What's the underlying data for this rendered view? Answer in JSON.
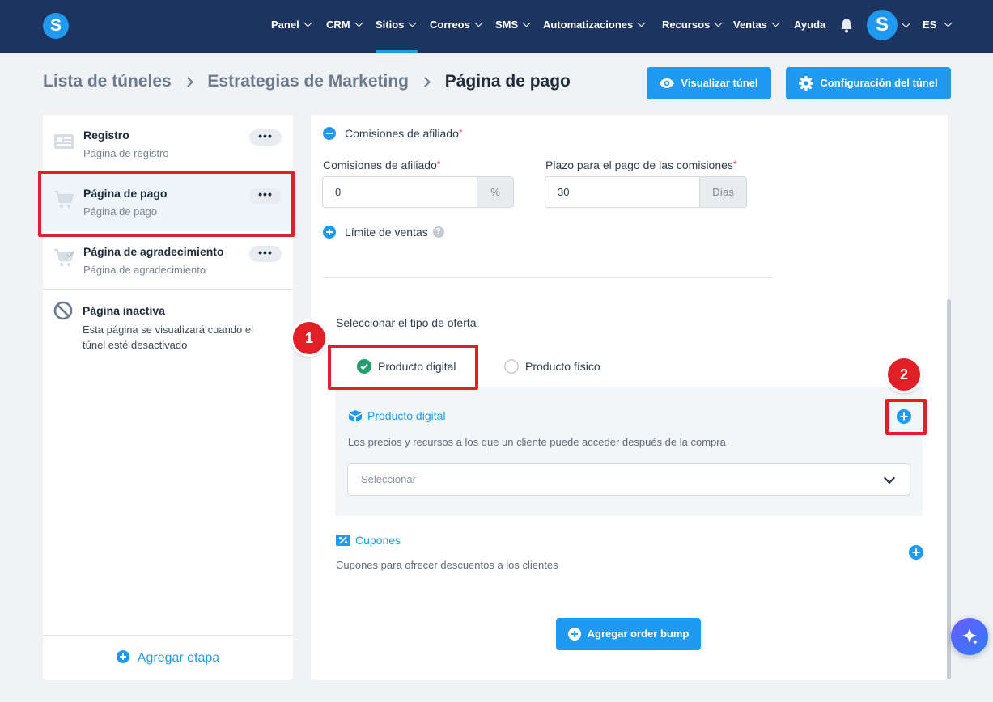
{
  "app": {
    "logo_letter": "S",
    "brand_color": "#1e9bf0",
    "nav_background": "#1d3461",
    "highlight_color": "#e01f26"
  },
  "nav": {
    "items": [
      {
        "label": "Panel",
        "has_chevron": true
      },
      {
        "label": "CRM",
        "has_chevron": true
      },
      {
        "label": "Sitios",
        "has_chevron": true,
        "active": true
      },
      {
        "label": "Correos",
        "has_chevron": true
      },
      {
        "label": "SMS",
        "has_chevron": true
      },
      {
        "label": "Automatizaciones",
        "has_chevron": true
      },
      {
        "label": "Recursos",
        "has_chevron": true
      },
      {
        "label": "Ventas",
        "has_chevron": true
      },
      {
        "label": "Ayuda",
        "has_chevron": false
      }
    ],
    "bell_icon": "bell-icon",
    "avatar_letter": "S",
    "language": "ES"
  },
  "header": {
    "breadcrumb": [
      "Lista de túneles",
      "Estrategias de Marketing",
      "Página de pago"
    ],
    "preview_button": "Visualizar túnel",
    "preview_icon": "eye-icon",
    "settings_button": "Configuración del túnel",
    "settings_icon": "gear-icon"
  },
  "sidebar": {
    "steps": [
      {
        "title": "Registro",
        "subtitle": "Página de registro",
        "icon": "form-icon",
        "menu": "•••"
      },
      {
        "title": "Página de pago",
        "subtitle": "Página de pago",
        "icon": "cart-icon",
        "menu": "•••",
        "active": true
      },
      {
        "title": "Página de agradecimiento",
        "subtitle": "Página de agradecimiento",
        "icon": "cart-check-icon",
        "menu": "•••"
      }
    ],
    "inactive": {
      "title": "Página inactiva",
      "description": "Esta página se visualizará cuando el túnel esté desactivado",
      "icon": "ban-icon"
    },
    "add_stage": "Agregar etapa"
  },
  "main": {
    "affiliate_toggle": "Comisiones de afiliado",
    "commission_label": "Comisiones de afiliado",
    "commission_value": "0",
    "commission_unit": "%",
    "payment_term_label": "Plazo para el pago de las comisiones",
    "payment_term_value": "30",
    "payment_term_unit": "Días",
    "required_mark": "*",
    "sales_limit": "Límite de ventas",
    "help_mark": "?",
    "offer_type_label": "Seleccionar el tipo de oferta",
    "offer_options": [
      {
        "label": "Producto digital",
        "selected": true
      },
      {
        "label": "Producto físico",
        "selected": false
      }
    ],
    "digital_product": {
      "title": "Producto digital",
      "icon": "box-icon",
      "description": "Los precios y recursos a los que un cliente puede acceder después de la compra",
      "select_placeholder": "Seleccionar"
    },
    "coupons": {
      "title": "Cupones",
      "icon": "coupon-icon",
      "description": "Cupones para ofrecer descuentos a los clientes"
    },
    "order_bump_button": "Agregar order bump"
  },
  "annotations": {
    "marker_1": "1",
    "marker_2": "2"
  },
  "assistant_icon": "sparkle-icon"
}
